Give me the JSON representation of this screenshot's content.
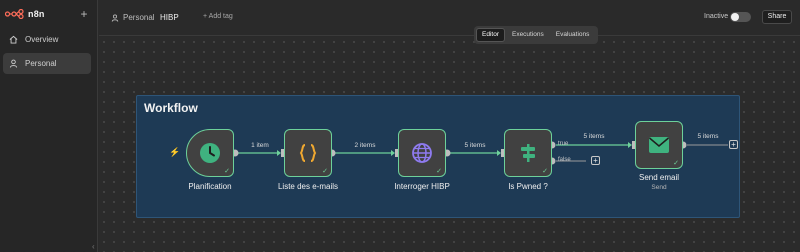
{
  "sidebar": {
    "logo_text": "n8n",
    "add_symbol": "+",
    "items": [
      {
        "label": "Overview",
        "icon": "home-icon"
      },
      {
        "label": "Personal",
        "icon": "user-icon",
        "active": true
      }
    ]
  },
  "header": {
    "breadcrumb_project": "Personal",
    "breadcrumb_separator": "",
    "workflow_name": "HIBP",
    "add_tag": "+ Add tag",
    "active_label": "Inactive",
    "active": false,
    "share_label": "Share"
  },
  "tabs": [
    {
      "label": "Editor",
      "active": true
    },
    {
      "label": "Executions",
      "active": false
    },
    {
      "label": "Evaluations",
      "active": false
    }
  ],
  "canvas": {
    "sticky_title": "Workflow",
    "nodes": [
      {
        "label": "Planification",
        "icon": "clock-icon",
        "status": "success"
      },
      {
        "label": "Liste des e-mails",
        "icon": "code-braces-icon",
        "status": "success"
      },
      {
        "label": "Interroger HIBP",
        "icon": "globe-icon",
        "status": "success"
      },
      {
        "label": "Is Pwned ?",
        "icon": "if-branch-icon",
        "status": "success"
      },
      {
        "label": "Send email",
        "sublabel": "Send",
        "icon": "envelope-icon",
        "status": "success"
      }
    ],
    "edges": [
      "1 item",
      "2 items",
      "5 items",
      "5 items",
      "5 items"
    ],
    "branches": {
      "true": "true",
      "false": "false"
    },
    "check_mark": "✓",
    "plus_symbol": "+",
    "trigger_symbol": "⚡"
  },
  "colors": {
    "success_border": "#6dd19a",
    "sticky_bg": "#1e3a55",
    "brand": "#ff6d5a"
  }
}
